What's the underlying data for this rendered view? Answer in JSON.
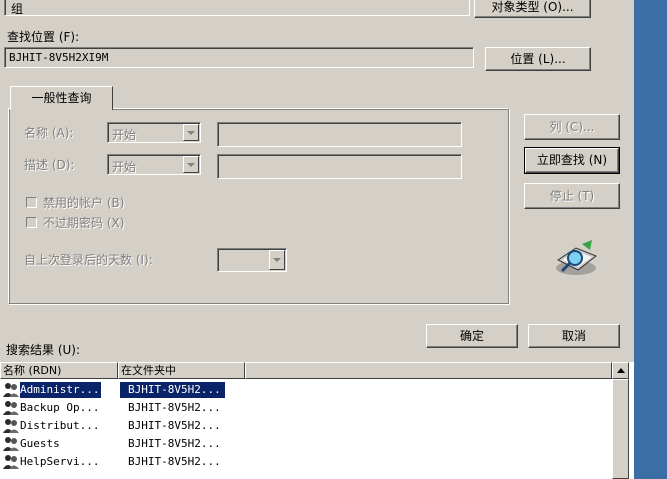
{
  "top": {
    "object_type_value": "组",
    "object_type_button": "对象类型 (O)...",
    "find_in_label": "查找位置 (F):",
    "find_in_value": "BJHIT-8V5H2XI9M",
    "location_button": "位置 (L)..."
  },
  "tab": {
    "label": "一般性查询"
  },
  "query": {
    "name_label": "名称 (A):",
    "name_combo": "开始",
    "desc_label": "描述 (D):",
    "desc_combo": "开始",
    "disabled_accounts": "禁用的帐户 (B)",
    "non_expiring": "不过期密码 (X)",
    "days_label": "自上次登录后的天数 (I):"
  },
  "buttons": {
    "columns": "列 (C)...",
    "find_now": "立即查找 (N)",
    "stop": "停止 (T)",
    "ok": "确定",
    "cancel": "取消"
  },
  "results": {
    "label": "搜索结果 (U):",
    "columns": [
      "名称 (RDN)",
      "在文件夹中"
    ],
    "rows": [
      {
        "name": "Administr...",
        "folder": "BJHIT-8V5H2...",
        "selected": true
      },
      {
        "name": "Backup Op...",
        "folder": "BJHIT-8V5H2...",
        "selected": false
      },
      {
        "name": "Distribut...",
        "folder": "BJHIT-8V5H2...",
        "selected": false
      },
      {
        "name": "Guests",
        "folder": "BJHIT-8V5H2...",
        "selected": false
      },
      {
        "name": "HelpServi...",
        "folder": "BJHIT-8V5H2...",
        "selected": false
      }
    ]
  },
  "icons": {
    "search_icon": "magnifier-icon",
    "group_icon": "users-group-icon",
    "scroll_up": "triangle-up-icon"
  }
}
